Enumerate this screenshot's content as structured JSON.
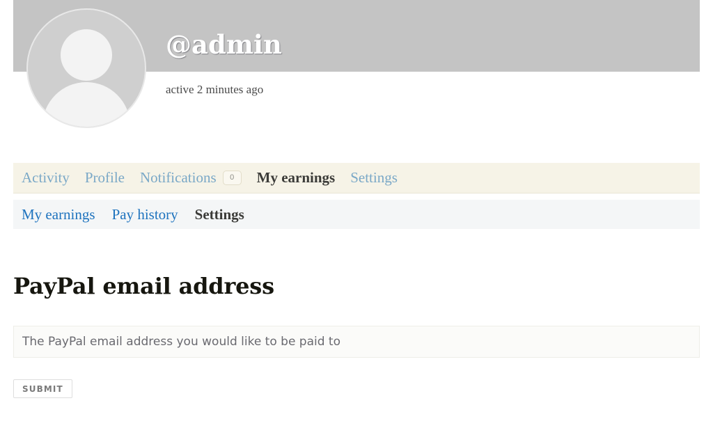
{
  "profile": {
    "username": "@admin",
    "activity_status": "active 2 minutes ago",
    "avatar_alt": "default-user-avatar"
  },
  "primary_nav": {
    "items": [
      {
        "label": "Activity",
        "current": false
      },
      {
        "label": "Profile",
        "current": false
      },
      {
        "label": "Notifications",
        "current": false,
        "count": "0"
      },
      {
        "label": "My earnings",
        "current": true
      },
      {
        "label": "Settings",
        "current": false
      }
    ]
  },
  "secondary_nav": {
    "items": [
      {
        "label": "My earnings",
        "current": false
      },
      {
        "label": "Pay history",
        "current": false
      },
      {
        "label": "Settings",
        "current": true
      }
    ]
  },
  "main": {
    "section_title": "PayPal email address",
    "paypal_email": {
      "value": "",
      "placeholder": "The PayPal email address you would like to be paid to"
    },
    "submit_label": "SUBMIT"
  },
  "colors": {
    "header_band": "#c4c4c4",
    "primary_nav_bg": "#f6f3e7",
    "primary_nav_link": "#7aa8c7",
    "secondary_nav_bg": "#f4f6f7",
    "secondary_nav_link": "#1e73be",
    "current_item": "#3b3b38",
    "heading": "#16160f"
  }
}
